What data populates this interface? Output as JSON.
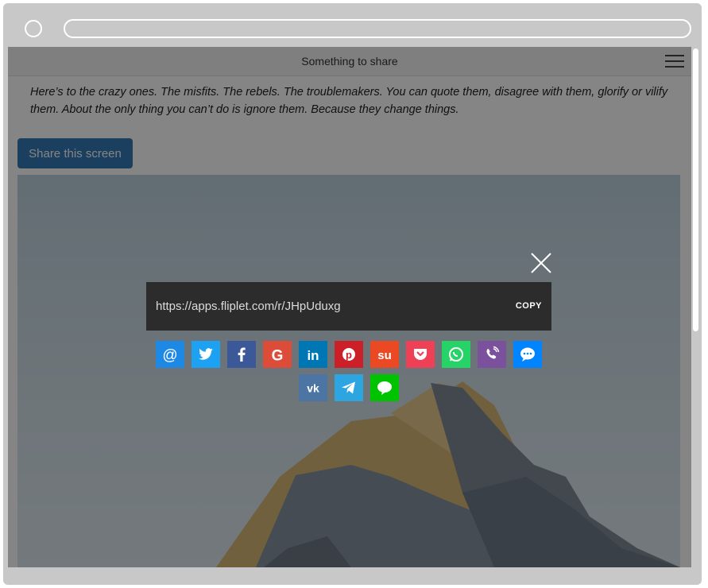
{
  "app": {
    "title": "Something to share"
  },
  "content": {
    "quote": "Here’s to the crazy ones. The misfits. The rebels. The troublemakers. You can quote them, disagree with them, glorify or vilify them. About the only thing you can’t do is ignore them. Because they change things.",
    "share_button_label": "Share this screen"
  },
  "share_dialog": {
    "url": "https://apps.fliplet.com/r/JHpUduxg",
    "copy_label": "COPY",
    "services": [
      {
        "name": "Email",
        "icon": "email-icon",
        "color": "#1e88e5"
      },
      {
        "name": "Twitter",
        "icon": "twitter-icon",
        "color": "#1da1f2"
      },
      {
        "name": "Facebook",
        "icon": "facebook-icon",
        "color": "#3b5998"
      },
      {
        "name": "Google",
        "icon": "google-icon",
        "color": "#dd4b39"
      },
      {
        "name": "LinkedIn",
        "icon": "linkedin-icon",
        "color": "#0077b5"
      },
      {
        "name": "Pinterest",
        "icon": "pinterest-icon",
        "color": "#cb2027"
      },
      {
        "name": "StumbleUpon",
        "icon": "stumbleupon-icon",
        "color": "#eb4924"
      },
      {
        "name": "Pocket",
        "icon": "pocket-icon",
        "color": "#ef4056"
      },
      {
        "name": "WhatsApp",
        "icon": "whatsapp-icon",
        "color": "#25d366"
      },
      {
        "name": "Viber",
        "icon": "viber-icon",
        "color": "#7b519d"
      },
      {
        "name": "Messenger",
        "icon": "messenger-icon",
        "color": "#0084ff"
      },
      {
        "name": "VK",
        "icon": "vk-icon",
        "color": "#4c75a3"
      },
      {
        "name": "Telegram",
        "icon": "telegram-icon",
        "color": "#2ca5e0"
      },
      {
        "name": "Line",
        "icon": "line-icon",
        "color": "#00c300"
      }
    ]
  }
}
